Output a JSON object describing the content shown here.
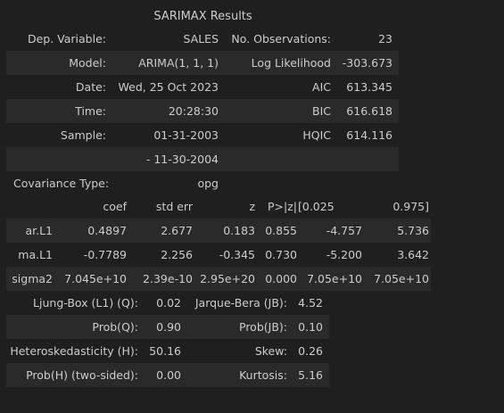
{
  "caption": "SARIMAX Results",
  "info_rows": [
    [
      "Dep. Variable:",
      "SALES",
      "No. Observations:",
      "23"
    ],
    [
      "Model:",
      "ARIMA(1, 1, 1)",
      "Log Likelihood",
      "-303.673"
    ],
    [
      "Date:",
      "Wed, 25 Oct 2023",
      "AIC",
      "613.345"
    ],
    [
      "Time:",
      "20:28:30",
      "BIC",
      "616.618"
    ],
    [
      "Sample:",
      "01-31-2003",
      "HQIC",
      "614.116"
    ],
    [
      "",
      "- 11-30-2004",
      "",
      ""
    ],
    [
      "Covariance Type:",
      "opg",
      "",
      ""
    ]
  ],
  "coef_header": [
    "",
    "coef",
    "std err",
    "z",
    "P>|z|",
    "[0.025",
    "0.975]"
  ],
  "coef_rows": [
    [
      "ar.L1",
      "0.4897",
      "2.677",
      "0.183",
      "0.855",
      "-4.757",
      "5.736"
    ],
    [
      "ma.L1",
      "-0.7789",
      "2.256",
      "-0.345",
      "0.730",
      "-5.200",
      "3.642"
    ],
    [
      "sigma2",
      "7.045e+10",
      "2.39e-10",
      "2.95e+20",
      "0.000",
      "7.05e+10",
      "7.05e+10"
    ]
  ],
  "diag_rows": [
    [
      "Ljung-Box (L1) (Q):",
      "0.02",
      "Jarque-Bera (JB):",
      "4.52"
    ],
    [
      "Prob(Q):",
      "0.90",
      "Prob(JB):",
      "0.10"
    ],
    [
      "Heteroskedasticity (H):",
      "50.16",
      "Skew:",
      "0.26"
    ],
    [
      "Prob(H) (two-sided):",
      "0.00",
      "Kurtosis:",
      "5.16"
    ]
  ]
}
